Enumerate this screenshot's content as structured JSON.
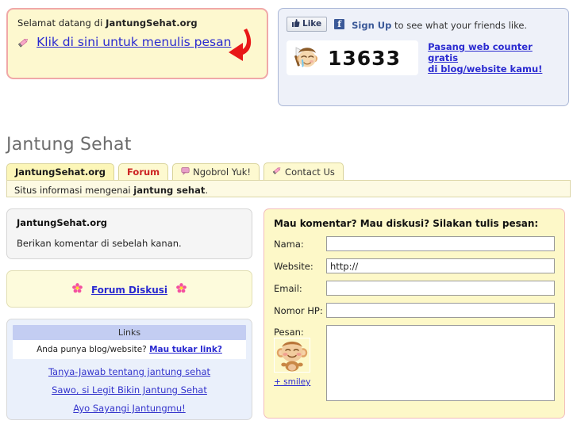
{
  "welcome": {
    "greeting_prefix": "Selamat datang di ",
    "site_name": "JantungSehat.org",
    "cta_link": "Klik di sini untuk menulis pesan",
    "pencil_icon": "pencil-icon",
    "arrow_icon": "red-curved-arrow-icon"
  },
  "facebook": {
    "like_label": "Like",
    "thumb_icon": "thumbs-up-icon",
    "f_logo": "facebook-f-icon",
    "signup_label": "Sign Up",
    "signup_suffix": " to see what your friends like.",
    "counter_value": "13633",
    "counter_icon": "crying-monkey-icon",
    "counter_link_line1": "Pasang web counter gratis",
    "counter_link_line2": "di blog/website kamu!"
  },
  "site": {
    "title": "Jantung Sehat",
    "tagline_prefix": "Situs informasi mengenai ",
    "tagline_bold": "jantung sehat",
    "tagline_suffix": "."
  },
  "tabs": [
    {
      "label": "JantungSehat.org",
      "active": true,
      "icon": null
    },
    {
      "label": "Forum",
      "active": false,
      "icon": null
    },
    {
      "label": "Ngobrol Yuk!",
      "active": false,
      "icon": "chat-icon"
    },
    {
      "label": "Contact Us",
      "active": false,
      "icon": "pencil-icon"
    }
  ],
  "sidebar": {
    "about": {
      "title": "JantungSehat.org",
      "body": "Berikan komentar di sebelah kanan."
    },
    "forum_box": {
      "left_icon": "flower-icon",
      "link": "Forum Diskusi",
      "right_icon": "flower-icon"
    },
    "links": {
      "header": "Links",
      "exchange_text": "Anda punya blog/website? ",
      "exchange_link": "Mau tukar link?",
      "items": [
        "Tanya-Jawab tentang jantung sehat",
        "Sawo, si Legit Bikin Jantung Sehat",
        "Ayo Sayangi Jantungmu!"
      ]
    }
  },
  "form": {
    "heading": "Mau komentar? Mau diskusi? Silakan tulis pesan:",
    "fields": [
      {
        "label": "Nama:",
        "value": "",
        "name": "nama-field"
      },
      {
        "label": "Website:",
        "value": "http://",
        "name": "website-field"
      },
      {
        "label": "Email:",
        "value": "",
        "name": "email-field"
      },
      {
        "label": "Nomor HP:",
        "value": "",
        "name": "nomor-hp-field"
      }
    ],
    "message_label": "Pesan:",
    "message_value": "",
    "smiley_icon": "monkey-smiley-icon",
    "smiley_link": "+ smiley"
  },
  "colors": {
    "welcome_bg": "#fdf8cf",
    "welcome_border": "#f0a8a8",
    "fb_bg": "#eef1f9",
    "fb_border": "#a9b6d6",
    "fb_brand": "#3b5998",
    "tab_bg": "#fdf9d0",
    "tab_active_bg": "#fcf6b8",
    "forum_tab_text": "#cc2222",
    "link_blue": "#2a2ad0",
    "links_header_bg": "#c3cdf2",
    "links_panel_bg": "#eaf0fb",
    "form_bg": "#fdf8c8",
    "form_border": "#f2bcbc",
    "arrow_red": "#e81818",
    "title_grey": "#6d6d6d"
  }
}
